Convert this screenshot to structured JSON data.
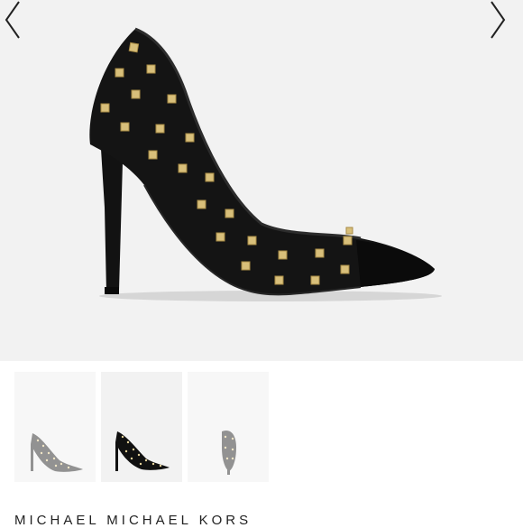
{
  "gallery": {
    "prev_icon": "chevron-left-icon",
    "next_icon": "chevron-right-icon",
    "selected_thumbnail": 2,
    "thumbnails": [
      {
        "view": "side",
        "state": "inactive"
      },
      {
        "view": "three-quarter",
        "state": "active"
      },
      {
        "view": "back",
        "state": "inactive"
      }
    ]
  },
  "product": {
    "brand": "MICHAEL MICHAEL KORS",
    "colors": {
      "background": "#f2f2f2",
      "leather": "#111111",
      "studs": "#d8bf7a"
    }
  }
}
